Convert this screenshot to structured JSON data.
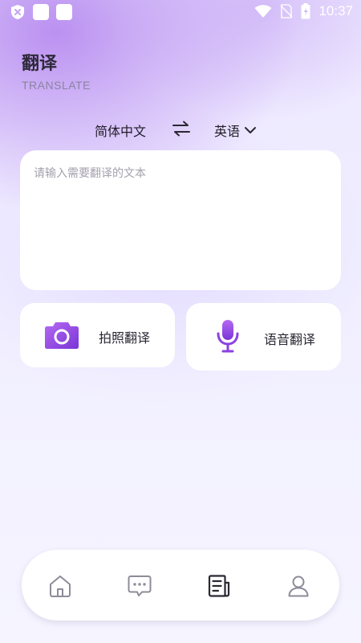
{
  "status_bar": {
    "time": "10:37",
    "icons": [
      "shield-x-icon",
      "notification-square-icon",
      "notification-square-icon",
      "wifi-icon",
      "no-sim-icon",
      "battery-icon"
    ]
  },
  "header": {
    "title": "翻译",
    "subtitle": "TRANSLATE"
  },
  "language_bar": {
    "source": "简体中文",
    "target": "英语",
    "swap_icon": "swap-arrows-icon"
  },
  "input": {
    "placeholder": "请输入需要翻译的文本",
    "value": ""
  },
  "actions": {
    "photo_label": "拍照翻译",
    "voice_label": "语音翻译"
  },
  "bottom_nav": {
    "items": [
      {
        "icon": "home-icon",
        "active": false
      },
      {
        "icon": "chat-icon",
        "active": false
      },
      {
        "icon": "document-icon",
        "active": true
      },
      {
        "icon": "user-icon",
        "active": false
      }
    ]
  },
  "colors": {
    "accent": "#9a4ee8",
    "accent_dark": "#7a35d6",
    "text": "#2e2a3a",
    "icon_inactive": "#8f8b98",
    "icon_active": "#2b2833"
  }
}
